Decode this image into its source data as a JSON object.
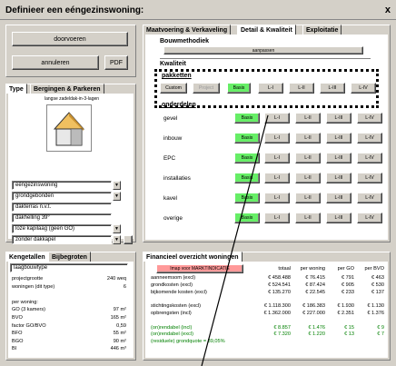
{
  "title": "Definieer een eéngezinswoning:",
  "close_label": "x",
  "left": {
    "doorvoeren": "doorvoeren",
    "annuleren": "annuleren",
    "pdf": "PDF",
    "tabs": [
      "Type",
      "Bergingen & Parkeren"
    ],
    "house_caption": "langse zadeldak-in-3-lagen",
    "type_fields": [
      {
        "value": "eéngezinswoning",
        "combo": true
      },
      {
        "value": "grondgebonden",
        "combo": true
      },
      {
        "value": "dakterras n.v.t.",
        "combo": false
      },
      {
        "value": "dakhelling 39°",
        "combo": false
      },
      {
        "value": "loze kapilaag (geen GO)",
        "combo": true
      },
      {
        "value": "zonder dakkapel",
        "combo": true
      }
    ]
  },
  "kengetallen": {
    "tabs": [
      "Kengetallen",
      "Bijbegroten"
    ],
    "field": "laagbouwtype",
    "rows": [
      {
        "label": "projectgrootte",
        "value": "240 weq"
      },
      {
        "label": "woningen (dit type)",
        "value": "6"
      },
      {
        "label": "",
        "value": ""
      },
      {
        "label": "per woning:",
        "value": ""
      },
      {
        "label": "GO   (3 kamers)",
        "value": "97 m²"
      },
      {
        "label": "BVO",
        "value": "165 m²"
      },
      {
        "label": "factor GO/BVO",
        "value": "0,59"
      },
      {
        "label": "BFO",
        "value": "55 m²"
      },
      {
        "label": "BGO",
        "value": "90 m²"
      },
      {
        "label": "BI",
        "value": "446 m³"
      }
    ]
  },
  "right": {
    "tabs": [
      "Maatvoering & Verkaveling",
      "Detail & Kwaliteit",
      "Exploitatie"
    ],
    "bouwmethodiek": "Bouwmethodiek",
    "aanpassen": "aanpassen",
    "kwaliteit": "Kwaliteit",
    "pakketten": "pakketten",
    "pakket_buttons": [
      {
        "label": "Custom",
        "green": false
      },
      {
        "label": "Project",
        "green": false
      },
      {
        "label": "Basis",
        "green": true
      },
      {
        "label": "L-I",
        "green": false
      },
      {
        "label": "L-II",
        "green": false
      },
      {
        "label": "L-III",
        "green": false
      },
      {
        "label": "L-IV",
        "green": false
      }
    ],
    "onderdelen": "onderdelen",
    "onderdelen_rows": [
      {
        "label": "gevel"
      },
      {
        "label": "inbouw"
      },
      {
        "label": "EPC"
      },
      {
        "label": "installaties"
      },
      {
        "label": "kavel"
      },
      {
        "label": "overige"
      }
    ],
    "levels": [
      "Basis",
      "L-I",
      "L-II",
      "L-III",
      "L-IV"
    ]
  },
  "financieel": {
    "tab": "Financieel overzicht woningen",
    "imap_button": "Imap voor MARKTINDICATIE",
    "headers": [
      "totaal",
      "per woning",
      "per GO",
      "per BVO"
    ],
    "rows": [
      {
        "label": "aanneemsom (excl)",
        "values": [
          "€ 458.488",
          "€ 76.415",
          "€ 791",
          "€ 463"
        ],
        "green": false
      },
      {
        "label": "grondkosten (excl)",
        "values": [
          "€ 524.541",
          "€ 87.424",
          "€ 905",
          "€ 530"
        ],
        "green": false
      },
      {
        "label": "bijkomende kosten (excl)",
        "values": [
          "€ 135.270",
          "€ 22.545",
          "€ 233",
          "€ 137"
        ],
        "green": false
      },
      {
        "label": "",
        "values": [
          "",
          "",
          "",
          ""
        ],
        "green": false
      },
      {
        "label": "stichtingskosten (excl)",
        "values": [
          "€ 1.118.300",
          "€ 186.383",
          "€ 1.930",
          "€ 1.130"
        ],
        "green": false
      },
      {
        "label": "opbrengsten (incl)",
        "values": [
          "€ 1.362.000",
          "€ 227.000",
          "€ 2.351",
          "€ 1.376"
        ],
        "green": false
      },
      {
        "label": "",
        "values": [
          "",
          "",
          "",
          ""
        ],
        "green": false
      },
      {
        "label": "(on)rendabel (incl)",
        "values": [
          "€ 8.857",
          "€ 1.476",
          "€ 15",
          "€ 9"
        ],
        "green": true
      },
      {
        "label": "(on)rendabel (excl)",
        "values": [
          "€ 7.320",
          "€ 1.220",
          "€ 13",
          "€ 7"
        ],
        "green": true
      },
      {
        "label": "(residuele) grondquote = 39,05%",
        "values": [
          "",
          "",
          "",
          ""
        ],
        "green": true
      }
    ]
  },
  "colors": {
    "green_button": "#66ee66",
    "pink_button": "#ff9999",
    "green_text": "#008000",
    "form_bg": "#d4d0c8"
  }
}
